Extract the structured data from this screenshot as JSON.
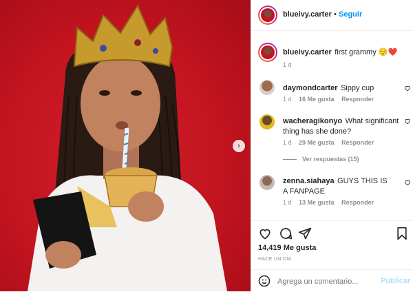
{
  "post": {
    "username": "blueivy.carter",
    "follow_label": "Seguir",
    "caption": "first grammy 😌❤️",
    "caption_time": "1 d"
  },
  "comments": [
    {
      "username": "daymondcarter",
      "text": "Sippy cup",
      "time": "1 d",
      "likes": "16 Me gusta",
      "reply": "Responder"
    },
    {
      "username": "wacheragikonyo",
      "text": "What significant thing has she done?",
      "time": "1 d",
      "likes": "29 Me gusta",
      "reply": "Responder",
      "view_replies": "Ver respuestas (15)"
    },
    {
      "username": "zenna.siahaya",
      "text": "GUYS THIS IS A FANPAGE",
      "time": "1 d",
      "likes": "13 Me gusta",
      "reply": "Responder"
    }
  ],
  "actions": {
    "likes": "14,419 Me gusta",
    "timestamp": "HACE UN DÍA"
  },
  "comment_box": {
    "placeholder": "Agrega un comentario...",
    "publish_label": "Publicar"
  },
  "colors": {
    "accent": "#0095f6",
    "background_red": "#c3141f",
    "meta_gray": "#8e8e8e"
  }
}
